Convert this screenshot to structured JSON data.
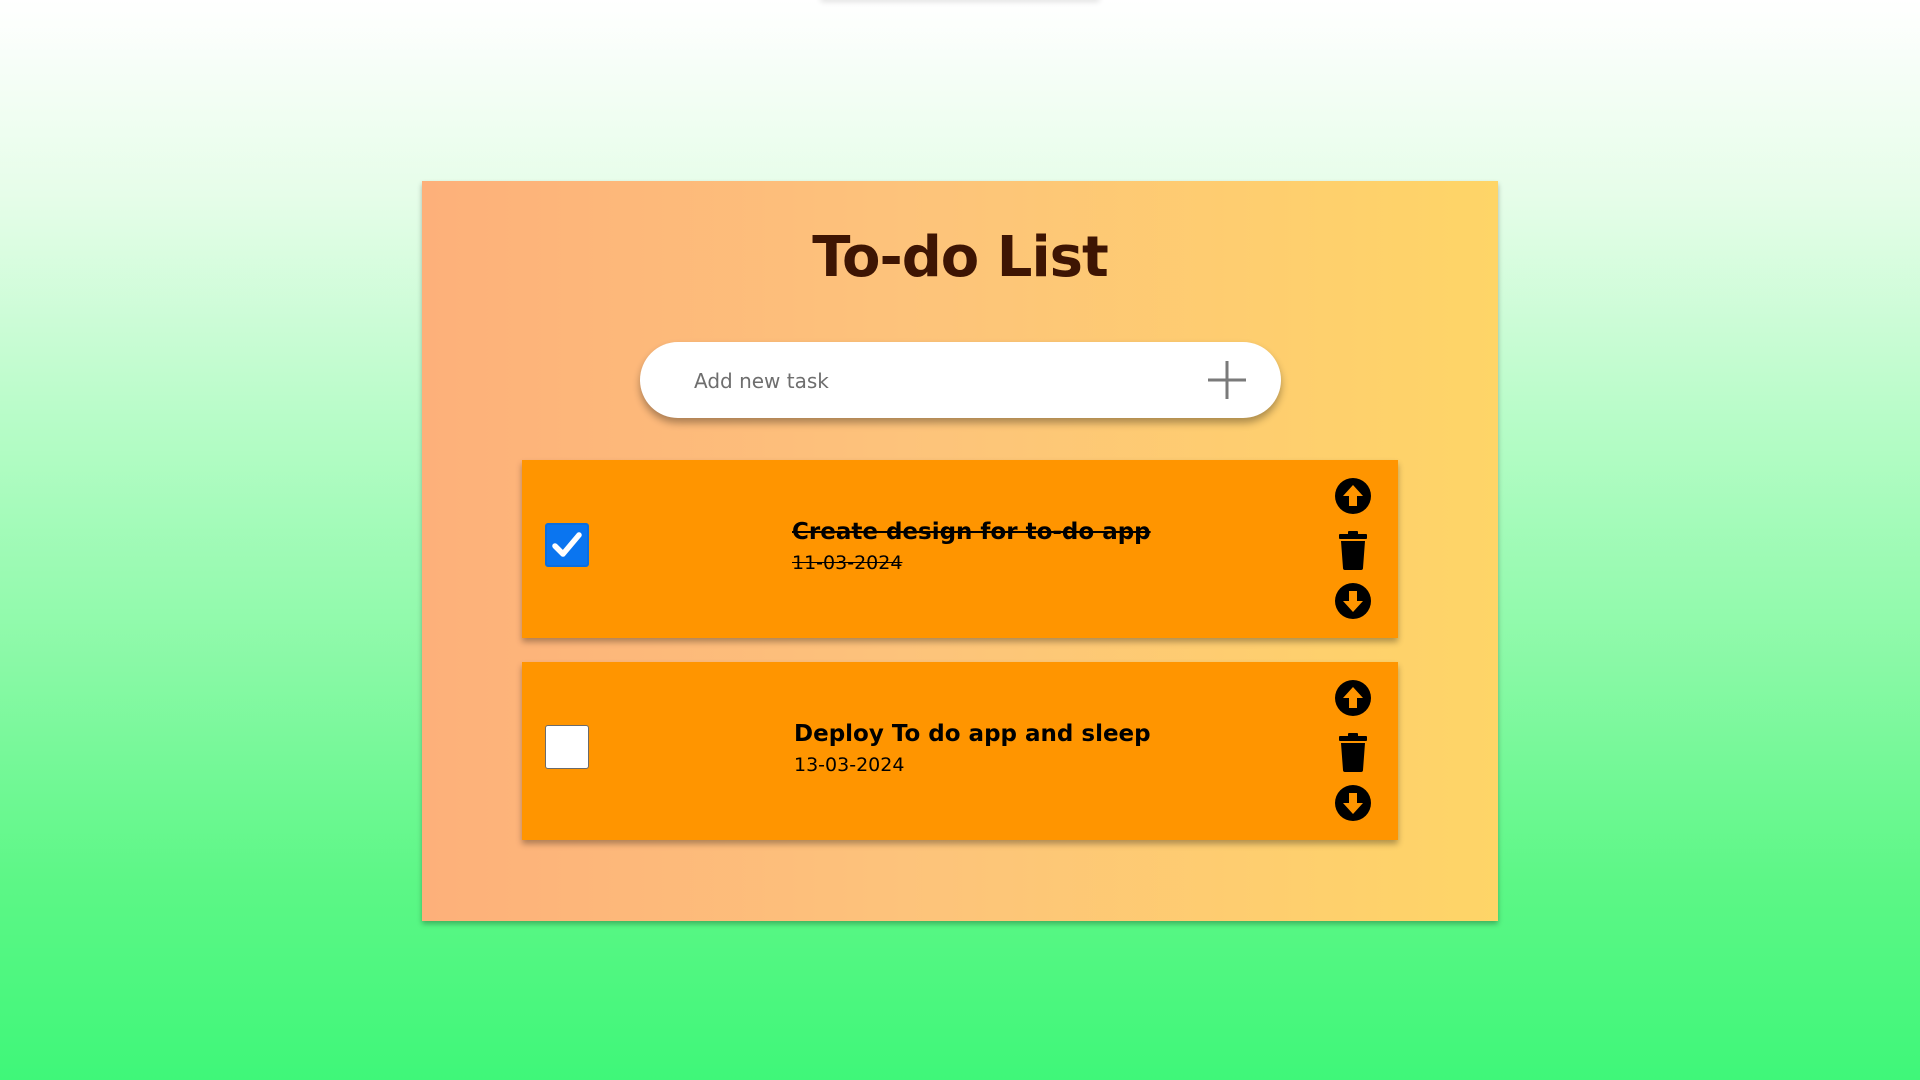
{
  "app": {
    "title": "To-do List"
  },
  "add_task": {
    "placeholder": "Add new task",
    "button_icon": "plus-icon"
  },
  "tasks": [
    {
      "name": "Create design for to-do app",
      "date": "11-03-2024",
      "completed": true
    },
    {
      "name": "Deploy To do app and sleep",
      "date": "13-03-2024",
      "completed": false
    }
  ],
  "task_actions": {
    "move_up_icon": "arrow-up-circle-icon",
    "delete_icon": "trash-icon",
    "move_down_icon": "arrow-down-circle-icon"
  },
  "colors": {
    "page_gradient_top": "#ffffff",
    "page_gradient_bottom": "#3ff779",
    "card_gradient_left": "#fdb07a",
    "card_gradient_right": "#fed567",
    "task_background": "#ff9500",
    "title_color": "#3e1503",
    "checkbox_checked": "#0a75f0"
  }
}
